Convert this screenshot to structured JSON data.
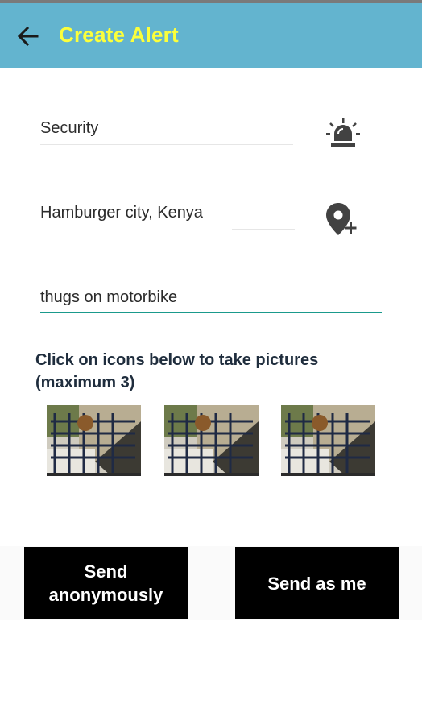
{
  "app_bar": {
    "title": "Create Alert",
    "back_icon": "arrow-left-icon",
    "background": "#63b4cf",
    "title_color": "#fbff3b"
  },
  "form": {
    "category_value": "Security",
    "category_icon": "alarm-siren-icon",
    "location_value": "Hamburger city, Kenya",
    "location_icon": "add-location-icon",
    "description_value": "thugs on motorbike",
    "accent_color": "#1a9a8c"
  },
  "photos": {
    "instruction": "Click on icons below to take pictures (maximum 3)",
    "count": 3
  },
  "actions": {
    "send_anonymously": "Send anonymously",
    "send_as_me": "Send as me"
  }
}
